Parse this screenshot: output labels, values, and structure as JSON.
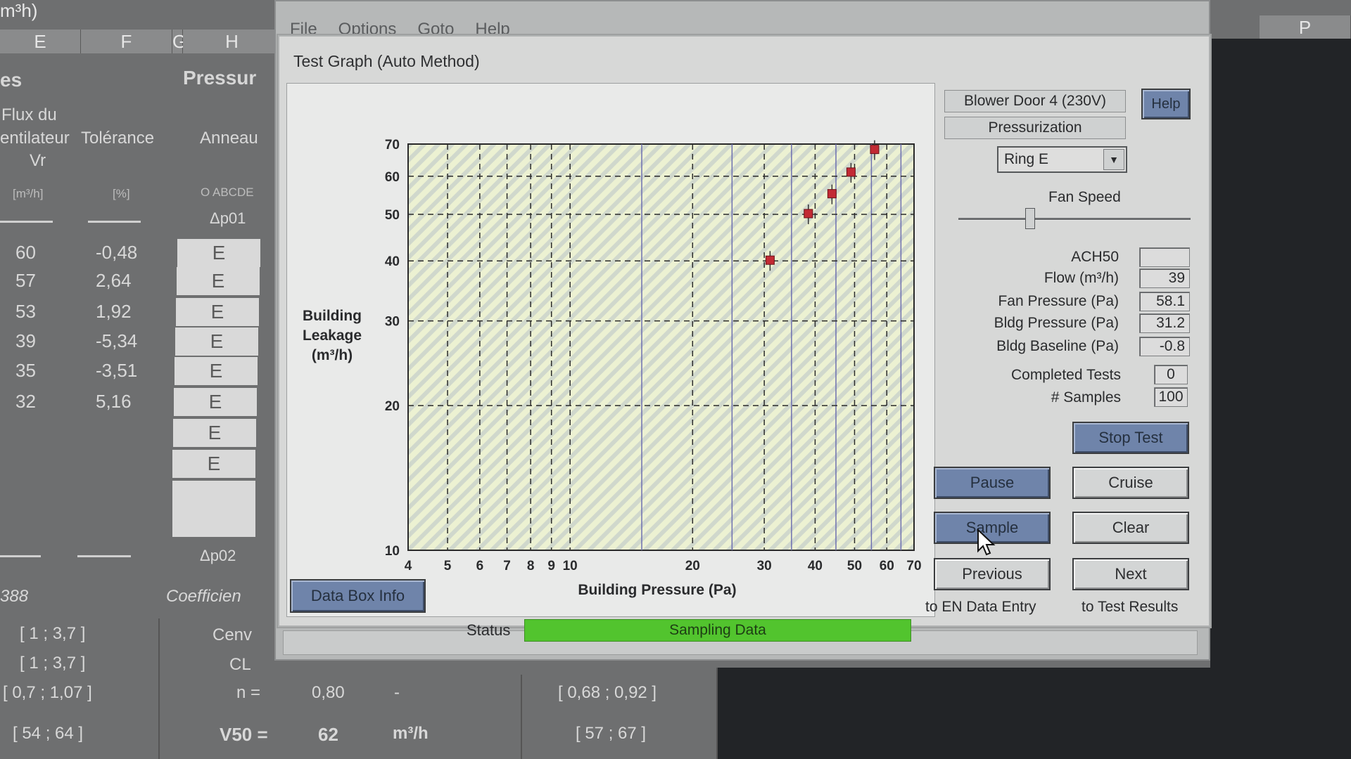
{
  "spreadsheet": {
    "topleft_text": "m³h)",
    "columns": [
      "E",
      "F",
      "G",
      "H"
    ],
    "far_right_column": "P",
    "section_left": "es",
    "section_right": "Pressur",
    "header_flux": [
      "Flux du",
      "entilateur",
      "Vr"
    ],
    "header_tolerance": "Tolérance",
    "header_ring": "Anneau",
    "unit_flux": "[m³/h]",
    "unit_tolerance": "[%]",
    "ring_letters": "O ABCDE",
    "delta_p01": "Δp01",
    "delta_p02": "Δp02",
    "rows": [
      {
        "flux": "60",
        "tol": "-0,48",
        "ring": "E"
      },
      {
        "flux": "57",
        "tol": "2,64",
        "ring": "E"
      },
      {
        "flux": "53",
        "tol": "1,92",
        "ring": "E"
      },
      {
        "flux": "39",
        "tol": "-5,34",
        "ring": "E"
      },
      {
        "flux": "35",
        "tol": "-3,51",
        "ring": "E"
      },
      {
        "flux": "32",
        "tol": "5,16",
        "ring": "E"
      },
      {
        "flux": "",
        "tol": "",
        "ring": "E"
      },
      {
        "flux": "",
        "tol": "",
        "ring": "E"
      }
    ],
    "bottom_left_code": "388",
    "coefficient_label": "Coefficien",
    "ranges_left": [
      "[ 1 ; 3,7 ]",
      "[ 1 ; 3,7 ]",
      "[ 0,7 ; 1,07 ]",
      "[ 54 ; 64 ]"
    ],
    "c_env": "Cenv",
    "c_l": "CL",
    "n_label": "n =",
    "n_value": "0,80",
    "n_dash": "-",
    "n_range": "[ 0,68 ; 0,92 ]",
    "v50_label": "V50 =",
    "v50_value": "62",
    "v50_unit": "m³/h",
    "v50_range": "[ 57 ; 67 ]"
  },
  "app": {
    "menu": [
      "File",
      "Options",
      "Goto",
      "Help"
    ]
  },
  "dialog": {
    "title": "Test Graph (Auto Method)",
    "device": "Blower Door 4 (230V)",
    "mode": "Pressurization",
    "ring": "Ring E",
    "fan_speed_label": "Fan Speed",
    "fan_speed_level": 0.3,
    "fields": [
      {
        "label": "ACH50",
        "value": ""
      },
      {
        "label": "Flow (m³/h)",
        "value": "39"
      },
      {
        "label": "Fan Pressure (Pa)",
        "value": "58.1"
      },
      {
        "label": "Bldg Pressure (Pa)",
        "value": "31.2"
      },
      {
        "label": "Bldg Baseline (Pa)",
        "value": "-0.8"
      }
    ],
    "completed_tests_label": "Completed Tests",
    "completed_tests": "0",
    "samples_label": "# Samples",
    "samples": "100",
    "buttons": {
      "help": "Help",
      "stop_test": "Stop Test",
      "pause": "Pause",
      "cruise": "Cruise",
      "sample": "Sample",
      "clear": "Clear",
      "previous": "Previous",
      "next": "Next",
      "data_box_info": "Data Box Info"
    },
    "previous_sub": "to EN Data Entry",
    "next_sub": "to Test Results",
    "status_label": "Status",
    "status_text": "Sampling Data"
  },
  "chart_data": {
    "type": "scatter",
    "xlabel": "Building Pressure (Pa)",
    "ylabel": [
      "Building",
      "Leakage",
      "(m³/h)"
    ],
    "xscale": "log",
    "yscale": "log",
    "xlim": [
      4,
      70
    ],
    "ylim": [
      10,
      70
    ],
    "xticks": [
      4,
      5,
      6,
      7,
      8,
      9,
      10,
      20,
      30,
      40,
      50,
      60,
      70
    ],
    "yticks": [
      10,
      20,
      30,
      40,
      50,
      60,
      70
    ],
    "grid": true,
    "points": [
      {
        "x": 31,
        "y": 40
      },
      {
        "x": 38.5,
        "y": 50
      },
      {
        "x": 44,
        "y": 55
      },
      {
        "x": 49,
        "y": 61
      },
      {
        "x": 56,
        "y": 68
      }
    ],
    "colors": {
      "background": "#ecf1d2",
      "stripe": "#c9d3cf",
      "grid": "#2a2a2a",
      "point": "#c22a34"
    }
  }
}
